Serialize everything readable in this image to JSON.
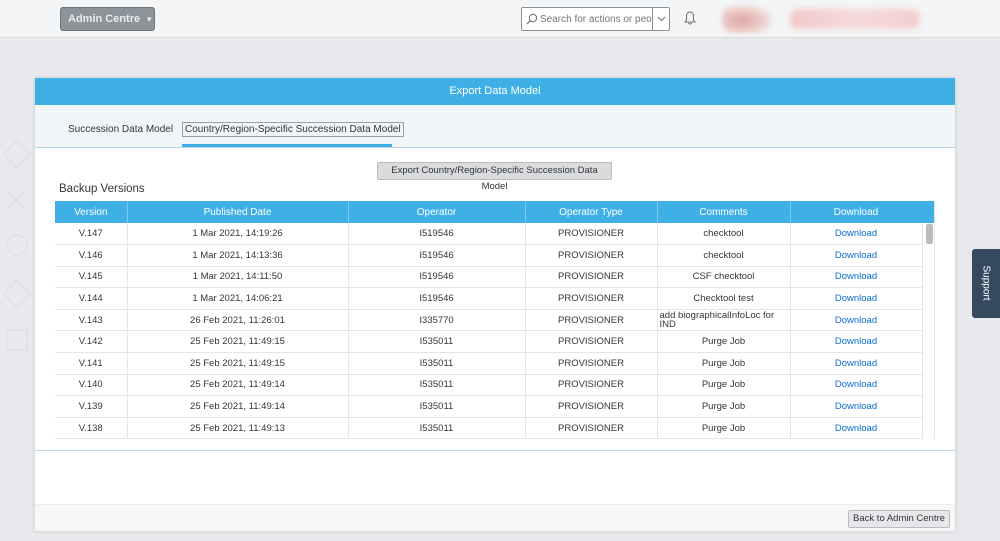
{
  "shell": {
    "admin_menu_label": "Admin Centre",
    "search_placeholder": "Search for actions or peo..."
  },
  "dialog": {
    "title": "Export Data Model",
    "tabs": [
      {
        "label": "Succession Data Model"
      },
      {
        "label": "Country/Region-Specific Succession Data Model"
      }
    ],
    "export_button_label": "Export Country/Region-Specific Succession Data Model",
    "section_title": "Backup Versions",
    "back_button_label": "Back to Admin Centre"
  },
  "table": {
    "headers": [
      "Version",
      "Published Date",
      "Operator",
      "Operator Type",
      "Comments",
      "Download"
    ],
    "rows": [
      {
        "version": "V.147",
        "date": "1 Mar 2021, 14:19:26",
        "operator": "I519546",
        "type": "PROVISIONER",
        "comments": "checktool",
        "download": "Download"
      },
      {
        "version": "V.146",
        "date": "1 Mar 2021, 14:13:36",
        "operator": "I519546",
        "type": "PROVISIONER",
        "comments": "checktool",
        "download": "Download"
      },
      {
        "version": "V.145",
        "date": "1 Mar 2021, 14:11:50",
        "operator": "I519546",
        "type": "PROVISIONER",
        "comments": "CSF checktool",
        "download": "Download"
      },
      {
        "version": "V.144",
        "date": "1 Mar 2021, 14:06:21",
        "operator": "I519546",
        "type": "PROVISIONER",
        "comments": "Checktool test",
        "download": "Download"
      },
      {
        "version": "V.143",
        "date": "26 Feb 2021, 11:26:01",
        "operator": "I335770",
        "type": "PROVISIONER",
        "comments": "add biographicalInfoLoc for IND",
        "download": "Download"
      },
      {
        "version": "V.142",
        "date": "25 Feb 2021, 11:49:15",
        "operator": "I535011",
        "type": "PROVISIONER",
        "comments": "Purge Job",
        "download": "Download"
      },
      {
        "version": "V.141",
        "date": "25 Feb 2021, 11:49:15",
        "operator": "I535011",
        "type": "PROVISIONER",
        "comments": "Purge Job",
        "download": "Download"
      },
      {
        "version": "V.140",
        "date": "25 Feb 2021, 11:49:14",
        "operator": "I535011",
        "type": "PROVISIONER",
        "comments": "Purge Job",
        "download": "Download"
      },
      {
        "version": "V.139",
        "date": "25 Feb 2021, 11:49:14",
        "operator": "I535011",
        "type": "PROVISIONER",
        "comments": "Purge Job",
        "download": "Download"
      },
      {
        "version": "V.138",
        "date": "25 Feb 2021, 11:49:13",
        "operator": "I535011",
        "type": "PROVISIONER",
        "comments": "Purge Job",
        "download": "Download"
      }
    ]
  },
  "support_label": "Support",
  "colors": {
    "accent": "#3fb0e6",
    "link": "#0a6ed1",
    "shell_button": "#8d9499",
    "support_tab": "#354a5f"
  }
}
